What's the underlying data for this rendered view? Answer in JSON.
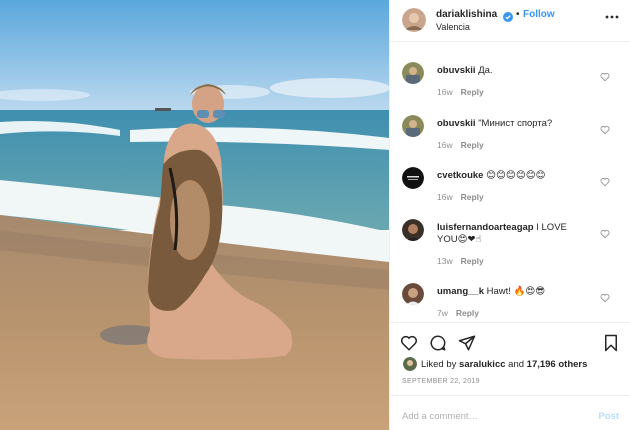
{
  "post": {
    "username": "dariaklishina",
    "follow_separator": "•",
    "follow_label": "Follow",
    "location": "Valencia"
  },
  "comments": [
    {
      "username": "obuvskii",
      "text": "Да.",
      "age": "16w",
      "reply_label": "Reply"
    },
    {
      "username": "obuvskii",
      "text": "\"Минист спорта?",
      "age": "16w",
      "reply_label": "Reply"
    },
    {
      "username": "cvetkouke",
      "text": "😊😊😊😊😊😊",
      "age": "16w",
      "reply_label": "Reply"
    },
    {
      "username": "luisfernandoarteagap",
      "text": "I LOVE YOU😍❤☝",
      "age": "13w",
      "reply_label": "Reply"
    },
    {
      "username": "umang__k",
      "text": "Hawt! 🔥😍😎",
      "age": "7w",
      "reply_label": "Reply"
    }
  ],
  "likes": {
    "prefix": "Liked by",
    "user": "saralukicc",
    "joiner": "and",
    "count": "17,196 others"
  },
  "date": "SEPTEMBER 22, 2019",
  "composer": {
    "placeholder": "Add a comment…",
    "post_label": "Post"
  },
  "colors": {
    "link_blue": "#3897f0",
    "post_disabled": "#b2dffc",
    "muted_text": "#8e8e8e",
    "divider": "#efefef"
  },
  "icons": {
    "like": "heart-icon",
    "comment": "comment-bubble-icon",
    "share": "paper-plane-icon",
    "save": "bookmark-icon",
    "more": "more-options-icon",
    "verified": "verified-badge-icon"
  }
}
